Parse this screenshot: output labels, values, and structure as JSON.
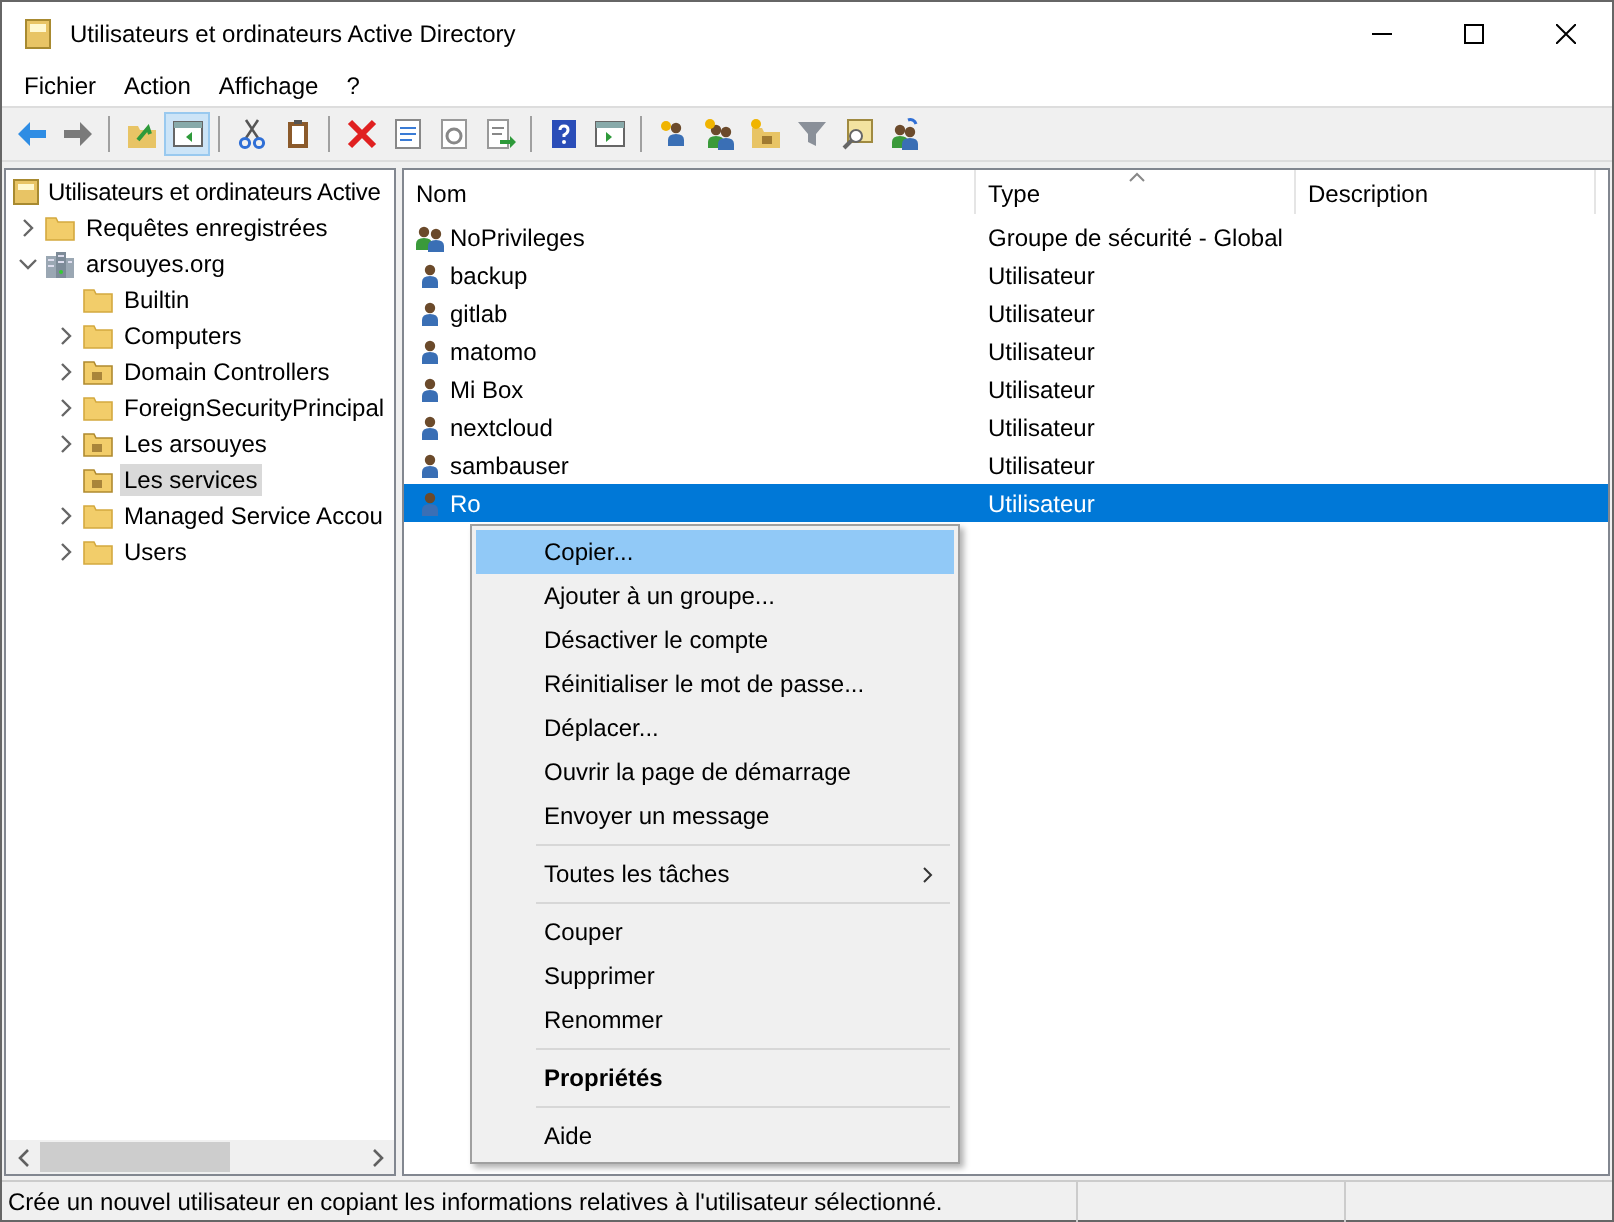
{
  "window": {
    "title": "Utilisateurs et ordinateurs Active Directory"
  },
  "menu_bar": [
    "Fichier",
    "Action",
    "Affichage",
    "?"
  ],
  "toolbar": [
    [
      {
        "kind": "back",
        "pressed": false
      },
      {
        "kind": "forward",
        "pressed": false
      }
    ],
    [
      {
        "kind": "up-folder",
        "pressed": false
      },
      {
        "kind": "tree-pane",
        "pressed": true
      }
    ],
    [
      {
        "kind": "cut",
        "pressed": false
      },
      {
        "kind": "paste",
        "pressed": false
      }
    ],
    [
      {
        "kind": "delete",
        "pressed": false
      },
      {
        "kind": "properties",
        "pressed": false
      },
      {
        "kind": "refresh",
        "pressed": false
      },
      {
        "kind": "export",
        "pressed": false
      }
    ],
    [
      {
        "kind": "help",
        "pressed": false
      },
      {
        "kind": "console",
        "pressed": false
      }
    ],
    [
      {
        "kind": "new-user",
        "pressed": false
      },
      {
        "kind": "new-group",
        "pressed": false
      },
      {
        "kind": "new-ou",
        "pressed": false
      },
      {
        "kind": "filter",
        "pressed": false
      },
      {
        "kind": "find",
        "pressed": false
      },
      {
        "kind": "add-to-group",
        "pressed": false
      }
    ]
  ],
  "tree": [
    {
      "label": "Utilisateurs et ordinateurs Active",
      "kind": "root",
      "selected": false,
      "children": [
        {
          "label": "Requêtes enregistrées",
          "kind": "folder",
          "expanded": false,
          "selected": false
        },
        {
          "label": "arsouyes.org",
          "kind": "domain",
          "expanded": true,
          "selected": false,
          "children": [
            {
              "label": "Builtin",
              "kind": "folder",
              "selected": false
            },
            {
              "label": "Computers",
              "kind": "folder",
              "expanded": false,
              "selected": false
            },
            {
              "label": "Domain Controllers",
              "kind": "ou",
              "expanded": false,
              "selected": false
            },
            {
              "label": "ForeignSecurityPrincipal",
              "kind": "folder",
              "expanded": false,
              "selected": false
            },
            {
              "label": "Les arsouyes",
              "kind": "ou",
              "expanded": false,
              "selected": false
            },
            {
              "label": "Les services",
              "kind": "ou",
              "selected": true
            },
            {
              "label": "Managed Service Accou",
              "kind": "folder",
              "expanded": false,
              "selected": false
            },
            {
              "label": "Users",
              "kind": "folder",
              "expanded": false,
              "selected": false
            }
          ]
        }
      ]
    }
  ],
  "list": {
    "columns": [
      "Nom",
      "Type",
      "Description"
    ],
    "rows": [
      {
        "name": "NoPrivileges",
        "type": "Groupe de sécurité - Global",
        "kind": "group",
        "selected": false
      },
      {
        "name": "backup",
        "type": "Utilisateur",
        "kind": "user",
        "selected": false
      },
      {
        "name": "gitlab",
        "type": "Utilisateur",
        "kind": "user",
        "selected": false
      },
      {
        "name": "matomo",
        "type": "Utilisateur",
        "kind": "user",
        "selected": false
      },
      {
        "name": "Mi Box",
        "type": "Utilisateur",
        "kind": "user",
        "selected": false
      },
      {
        "name": "nextcloud",
        "type": "Utilisateur",
        "kind": "user",
        "selected": false
      },
      {
        "name": "sambauser",
        "type": "Utilisateur",
        "kind": "user",
        "selected": false
      },
      {
        "name": "Ro",
        "type": "Utilisateur",
        "kind": "user",
        "selected": true
      }
    ]
  },
  "context_menu": [
    {
      "kind": "item",
      "label": "Copier...",
      "selected": true
    },
    {
      "kind": "item",
      "label": "Ajouter à un groupe...",
      "selected": false
    },
    {
      "kind": "item",
      "label": "Désactiver le compte",
      "selected": false
    },
    {
      "kind": "item",
      "label": "Réinitialiser le mot de passe...",
      "selected": false
    },
    {
      "kind": "item",
      "label": "Déplacer...",
      "selected": false
    },
    {
      "kind": "item",
      "label": "Ouvrir la page de démarrage",
      "selected": false
    },
    {
      "kind": "item",
      "label": "Envoyer un message",
      "selected": false
    },
    {
      "kind": "separator"
    },
    {
      "kind": "submenu",
      "label": "Toutes les tâches",
      "selected": false
    },
    {
      "kind": "separator"
    },
    {
      "kind": "item",
      "label": "Couper",
      "selected": false
    },
    {
      "kind": "item",
      "label": "Supprimer",
      "selected": false
    },
    {
      "kind": "item",
      "label": "Renommer",
      "selected": false
    },
    {
      "kind": "separator"
    },
    {
      "kind": "default",
      "label": "Propriétés",
      "selected": false
    },
    {
      "kind": "separator"
    },
    {
      "kind": "item",
      "label": "Aide",
      "selected": false
    }
  ],
  "status_bar": "Crée un nouvel utilisateur en copiant les informations relatives à l'utilisateur sélectionné."
}
